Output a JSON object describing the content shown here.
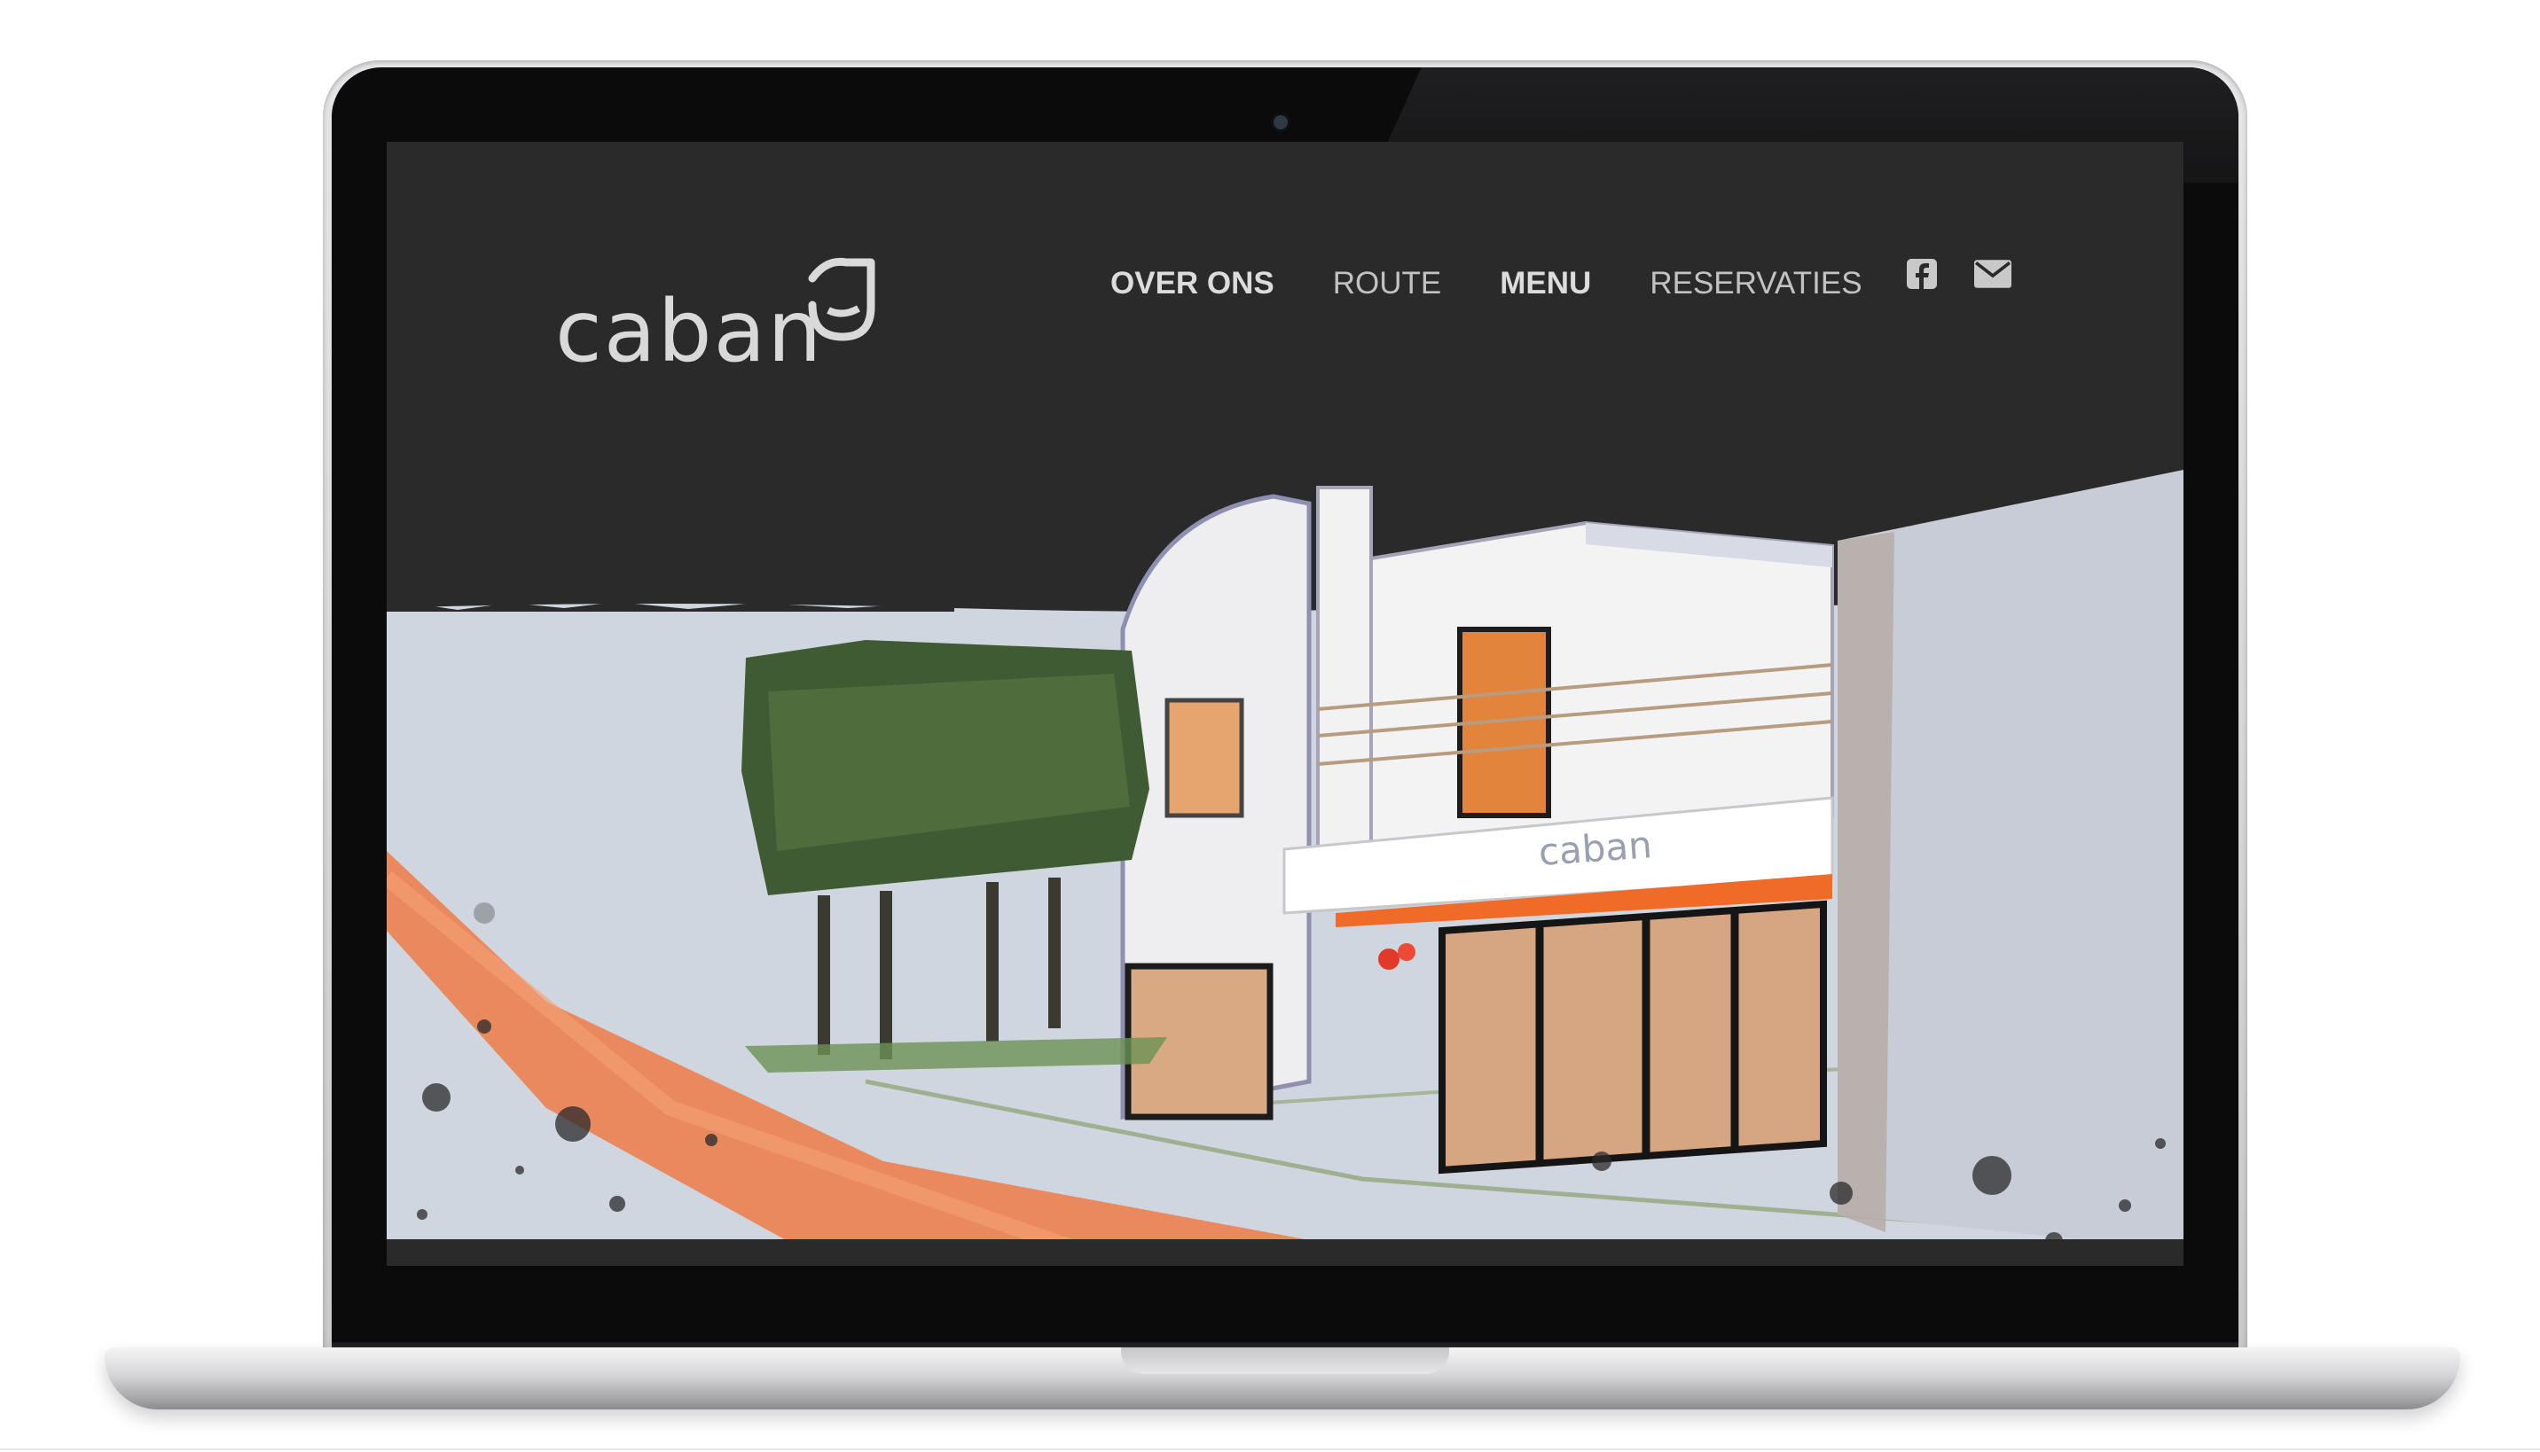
{
  "site": {
    "logo_text": "caban",
    "nav": [
      {
        "label": "OVER ONS",
        "bold": true
      },
      {
        "label": "ROUTE",
        "bold": false
      },
      {
        "label": "MENU",
        "bold": true
      },
      {
        "label": "RESERVATIES",
        "bold": false
      }
    ],
    "social": [
      {
        "icon": "facebook-icon"
      },
      {
        "icon": "mail-icon"
      }
    ],
    "hero": {
      "sign_text": "caban"
    }
  },
  "colors": {
    "header_bg": "#2a2a2b",
    "sky": "#cfd6e0",
    "accent_orange": "#f06a28",
    "nav_text": "#c2c2c2"
  }
}
